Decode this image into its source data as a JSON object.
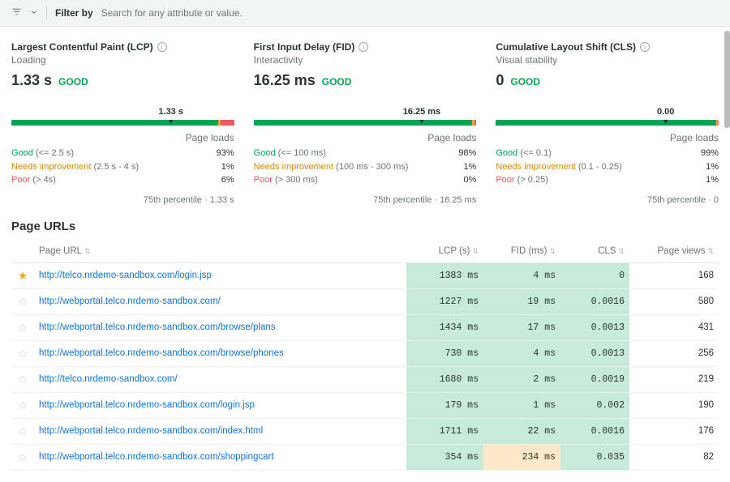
{
  "filter": {
    "label": "Filter by",
    "placeholder": "Search for any attribute or value."
  },
  "vitals": [
    {
      "title": "Largest Contentful Paint (LCP)",
      "sub": "Loading",
      "value": "1.33 s",
      "badge": "GOOD",
      "marker": "1.33 s",
      "bar": {
        "good": 93,
        "warn": 1,
        "poor": 6
      },
      "legend": [
        {
          "label": "Good",
          "cls": "legend-good",
          "range": "(<= 2.5 s)",
          "pct": "93%"
        },
        {
          "label": "Needs improvement",
          "cls": "legend-warn",
          "range": "(2.5 s - 4 s)",
          "pct": "1%"
        },
        {
          "label": "Poor",
          "cls": "legend-poor",
          "range": "(> 4s)",
          "pct": "6%"
        }
      ],
      "percentile": "75th percentile · 1.33 s"
    },
    {
      "title": "First Input Delay (FID)",
      "sub": "Interactivity",
      "value": "16.25 ms",
      "badge": "GOOD",
      "marker": "16.25 ms",
      "bar": {
        "good": 98,
        "warn": 1,
        "poor": 1
      },
      "legend": [
        {
          "label": "Good",
          "cls": "legend-good",
          "range": "(<= 100 ms)",
          "pct": "98%"
        },
        {
          "label": "Needs improvement",
          "cls": "legend-warn",
          "range": "(100 ms - 300 ms)",
          "pct": "1%"
        },
        {
          "label": "Poor",
          "cls": "legend-poor",
          "range": "(> 300 ms)",
          "pct": "0%"
        }
      ],
      "percentile": "75th percentile · 16.25 ms"
    },
    {
      "title": "Cumulative Layout Shift (CLS)",
      "sub": "Visual stability",
      "value": "0",
      "badge": "GOOD",
      "marker": "0.00",
      "bar": {
        "good": 99,
        "warn": 0.5,
        "poor": 0.5
      },
      "legend": [
        {
          "label": "Good",
          "cls": "legend-good",
          "range": "(<= 0.1)",
          "pct": "99%"
        },
        {
          "label": "Needs improvement",
          "cls": "legend-warn",
          "range": "(0.1 - 0.25)",
          "pct": "1%"
        },
        {
          "label": "Poor",
          "cls": "legend-poor",
          "range": "(> 0.25)",
          "pct": "1%"
        }
      ],
      "percentile": "75th percentile · 0"
    }
  ],
  "pageLoadsLabel": "Page loads",
  "section": {
    "title": "Page URLs"
  },
  "table": {
    "headers": {
      "url": "Page URL",
      "lcp": "LCP (s)",
      "fid": "FID (ms)",
      "cls": "CLS",
      "views": "Page views"
    },
    "rows": [
      {
        "star": true,
        "url": "http://telco.nrdemo-sandbox.com/login.jsp",
        "lcp": "1383 ms",
        "fid": "4 ms",
        "cls": "0",
        "views": "168",
        "fidCls": "cell-good"
      },
      {
        "star": false,
        "url": "http://webportal.telco.nrdemo-sandbox.com/",
        "lcp": "1227 ms",
        "fid": "19 ms",
        "cls": "0.0016",
        "views": "580",
        "fidCls": "cell-good"
      },
      {
        "star": false,
        "url": "http://webportal.telco.nrdemo-sandbox.com/browse/plans",
        "lcp": "1434 ms",
        "fid": "17 ms",
        "cls": "0.0013",
        "views": "431",
        "fidCls": "cell-good"
      },
      {
        "star": false,
        "url": "http://webportal.telco.nrdemo-sandbox.com/browse/phones",
        "lcp": "730 ms",
        "fid": "4 ms",
        "cls": "0.0013",
        "views": "256",
        "fidCls": "cell-good"
      },
      {
        "star": false,
        "url": "http://telco.nrdemo-sandbox.com/",
        "lcp": "1680 ms",
        "fid": "2 ms",
        "cls": "0.0019",
        "views": "219",
        "fidCls": "cell-good"
      },
      {
        "star": false,
        "url": "http://webportal.telco.nrdemo-sandbox.com/login.jsp",
        "lcp": "179 ms",
        "fid": "1 ms",
        "cls": "0.002",
        "views": "190",
        "fidCls": "cell-good"
      },
      {
        "star": false,
        "url": "http://webportal.telco.nrdemo-sandbox.com/index.html",
        "lcp": "1711 ms",
        "fid": "22 ms",
        "cls": "0.0016",
        "views": "176",
        "fidCls": "cell-good"
      },
      {
        "star": false,
        "url": "http://webportal.telco.nrdemo-sandbox.com/shoppingcart",
        "lcp": "354 ms",
        "fid": "234 ms",
        "cls": "0.035",
        "views": "82",
        "fidCls": "cell-warn"
      }
    ]
  },
  "chart_data": [
    {
      "type": "bar",
      "title": "Largest Contentful Paint (LCP)",
      "categories": [
        "Good",
        "Needs improvement",
        "Poor"
      ],
      "values": [
        93,
        1,
        6
      ],
      "ylabel": "Page loads %",
      "ylim": [
        0,
        100
      ]
    },
    {
      "type": "bar",
      "title": "First Input Delay (FID)",
      "categories": [
        "Good",
        "Needs improvement",
        "Poor"
      ],
      "values": [
        98,
        1,
        0
      ],
      "ylabel": "Page loads %",
      "ylim": [
        0,
        100
      ]
    },
    {
      "type": "bar",
      "title": "Cumulative Layout Shift (CLS)",
      "categories": [
        "Good",
        "Needs improvement",
        "Poor"
      ],
      "values": [
        99,
        1,
        1
      ],
      "ylabel": "Page loads %",
      "ylim": [
        0,
        100
      ]
    }
  ]
}
